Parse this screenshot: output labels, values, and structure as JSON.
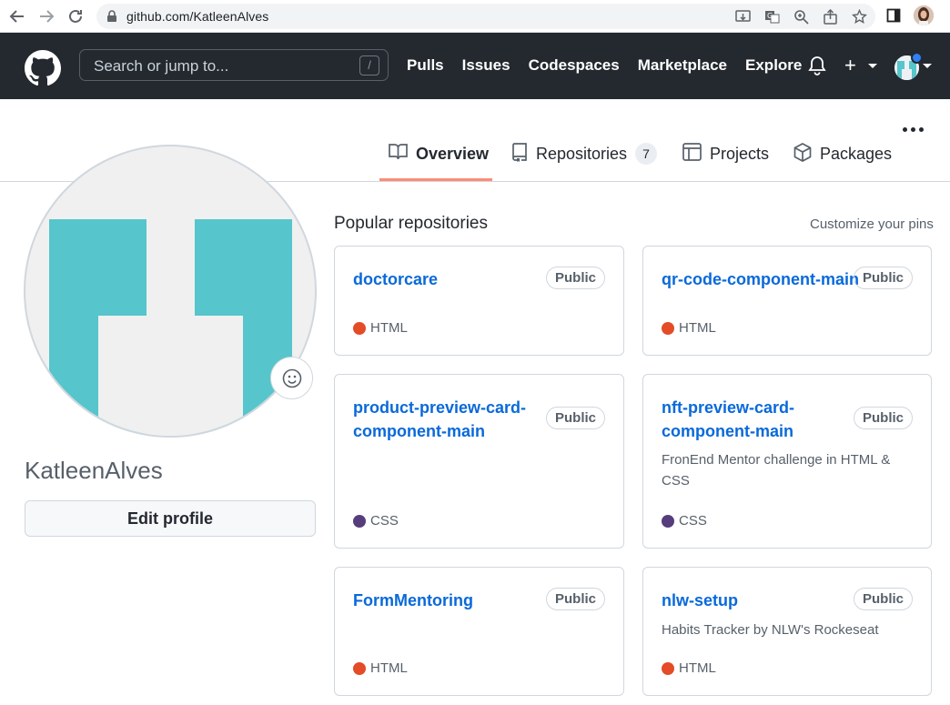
{
  "browser": {
    "url": "github.com/KatleenAlves"
  },
  "header": {
    "search_placeholder": "Search or jump to...",
    "search_shortcut": "/",
    "nav": [
      "Pulls",
      "Issues",
      "Codespaces",
      "Marketplace",
      "Explore"
    ],
    "plus_label": "+"
  },
  "tabs": [
    {
      "label": "Overview",
      "icon": "book-icon",
      "active": true
    },
    {
      "label": "Repositories",
      "icon": "repo-icon",
      "count": "7"
    },
    {
      "label": "Projects",
      "icon": "table-icon"
    },
    {
      "label": "Packages",
      "icon": "package-icon"
    }
  ],
  "profile": {
    "username": "KatleenAlves",
    "edit_label": "Edit profile",
    "avatar_color": "#56c5cc"
  },
  "popular": {
    "title": "Popular repositories",
    "customize_label": "Customize your pins",
    "repos": [
      {
        "name": "doctorcare",
        "visibility": "Public",
        "description": "",
        "language": "HTML",
        "language_color": "#e34c26"
      },
      {
        "name": "qr-code-component-main",
        "visibility": "Public",
        "description": "",
        "language": "HTML",
        "language_color": "#e34c26"
      },
      {
        "name": "product-preview-card-component-main",
        "name_line1": "product-preview-card-",
        "name_line2": "component-main",
        "visibility": "Public",
        "description": "",
        "language": "CSS",
        "language_color": "#563d7c"
      },
      {
        "name": "nft-preview-card-component-main",
        "name_line1": "nft-preview-card-",
        "name_line2": "component-main",
        "visibility": "Public",
        "description": "FronEnd Mentor challenge in HTML & CSS",
        "language": "CSS",
        "language_color": "#563d7c"
      },
      {
        "name": "FormMentoring",
        "visibility": "Public",
        "description": "",
        "language": "HTML",
        "language_color": "#e34c26"
      },
      {
        "name": "nlw-setup",
        "visibility": "Public",
        "description": "Habits Tracker by NLW's Rockeseat",
        "language": "HTML",
        "language_color": "#e34c26"
      }
    ]
  }
}
